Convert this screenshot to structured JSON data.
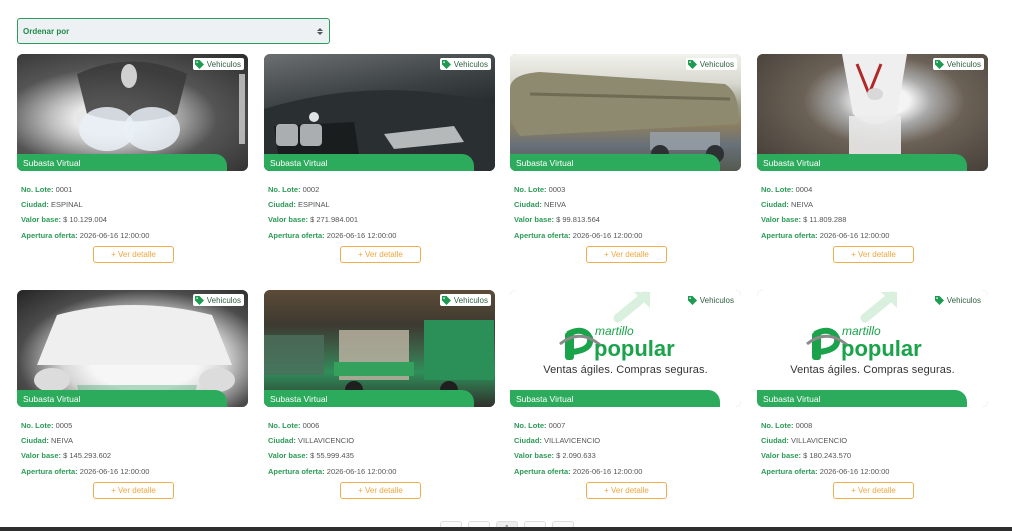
{
  "sort": {
    "label": "Ordenar por"
  },
  "labels": {
    "lote": "No. Lote:",
    "ciudad": "Ciudad:",
    "valor": "Valor base:",
    "apertura": "Apertura oferta:",
    "detail": "+ Ver detalle",
    "ribbon": "Subasta Virtual"
  },
  "logo": {
    "small": "martillo",
    "big": "popular",
    "slogan": "Ventas ágiles. Compras seguras."
  },
  "colors": {
    "accent": "#2cab5d",
    "button": "#f0ad4e",
    "select_border": "#2a9d5c"
  },
  "cards": [
    {
      "category": "Vehiculos",
      "lote": "0001",
      "ciudad": "ESPINAL",
      "valor": "$ 10.129.004",
      "apertura": "2026-06-16 12:00:00",
      "image": "motorcycle-front"
    },
    {
      "category": "Vehiculos",
      "lote": "0002",
      "ciudad": "ESPINAL",
      "valor": "$ 271.984.001",
      "apertura": "2026-06-16 12:00:00",
      "image": "bmw-suv-front"
    },
    {
      "category": "Vehiculos",
      "lote": "0003",
      "ciudad": "NEIVA",
      "valor": "$ 99.813.564",
      "apertura": "2026-06-16 12:00:00",
      "image": "tanker-truck"
    },
    {
      "category": "Vehiculos",
      "lote": "0004",
      "ciudad": "NEIVA",
      "valor": "$ 11.809.288",
      "apertura": "2026-06-16 12:00:00",
      "image": "white-motorcycle"
    },
    {
      "category": "Vehiculos",
      "lote": "0005",
      "ciudad": "NEIVA",
      "valor": "$ 145.293.602",
      "apertura": "2026-06-16 12:00:00",
      "image": "white-car-hood"
    },
    {
      "category": "Vehiculos",
      "lote": "0006",
      "ciudad": "VILLAVICENCIO",
      "valor": "$ 55.999.435",
      "apertura": "2026-06-16 12:00:00",
      "image": "green-trucks"
    },
    {
      "category": "Vehiculos",
      "lote": "0007",
      "ciudad": "VILLAVICENCIO",
      "valor": "$ 2.090.633",
      "apertura": "2026-06-16 12:00:00",
      "image": "logo"
    },
    {
      "category": "Vehiculos",
      "lote": "0008",
      "ciudad": "VILLAVICENCIO",
      "valor": "$ 180.243.570",
      "apertura": "2026-06-16 12:00:00",
      "image": "logo"
    }
  ]
}
